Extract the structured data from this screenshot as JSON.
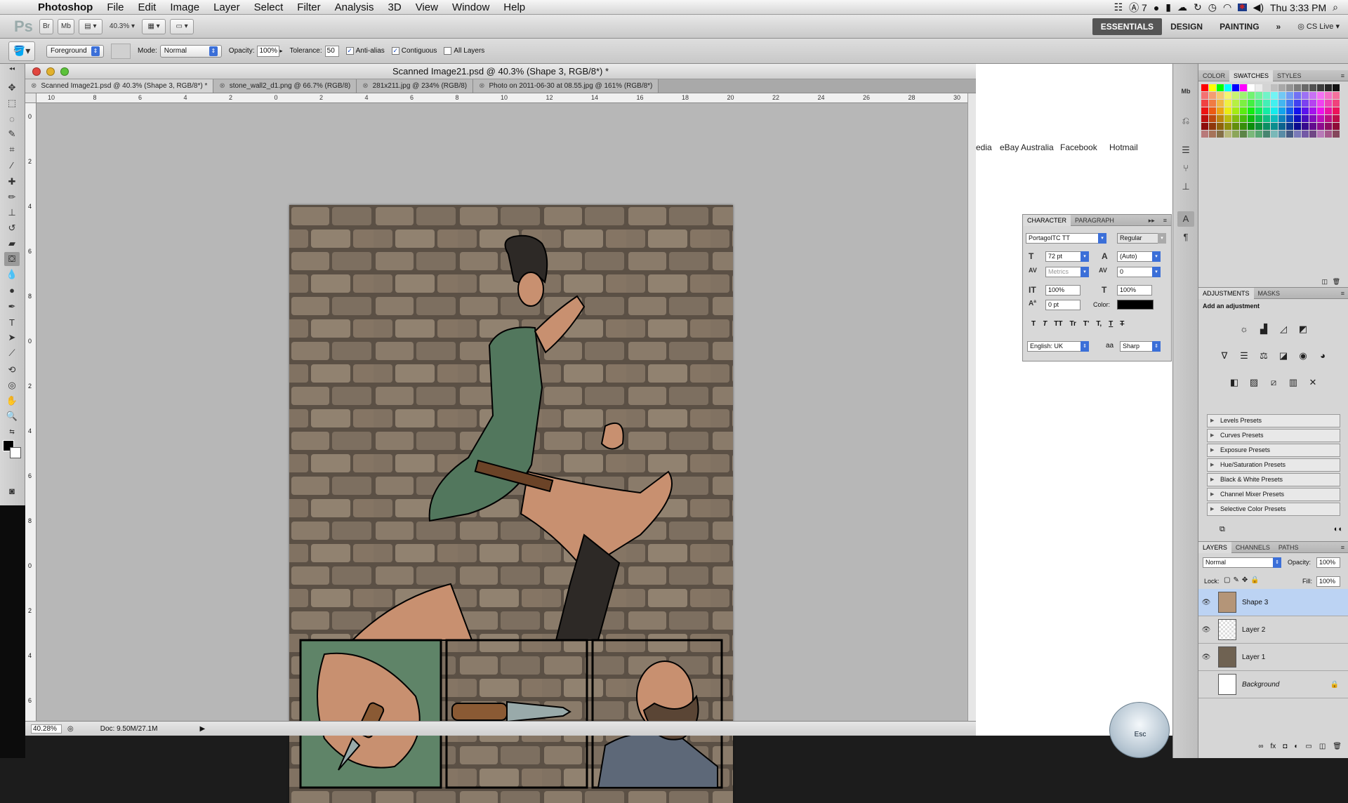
{
  "menubar": {
    "app": "Photoshop",
    "items": [
      "File",
      "Edit",
      "Image",
      "Layer",
      "Select",
      "Filter",
      "Analysis",
      "3D",
      "View",
      "Window",
      "Help"
    ],
    "right": {
      "battery_count": "7",
      "clock": "Thu 3:33 PM"
    }
  },
  "appbar": {
    "ps_logo": "Ps",
    "bridge": "Br",
    "minibridge": "Mb",
    "zoom": "40.3%",
    "workspaces": [
      "ESSENTIALS",
      "DESIGN",
      "PAINTING"
    ],
    "more": "»",
    "cslive": "CS Live"
  },
  "options": {
    "fill_source": "Foreground",
    "mode_label": "Mode:",
    "mode": "Normal",
    "opacity_label": "Opacity:",
    "opacity": "100%",
    "tolerance_label": "Tolerance:",
    "tolerance": "50",
    "antialias": "Anti-alias",
    "contiguous": "Contiguous",
    "all_layers": "All Layers"
  },
  "document": {
    "title": "Scanned Image21.psd @ 40.3% (Shape 3, RGB/8*) *",
    "tabs": [
      {
        "label": "Scanned Image21.psd @ 40.3% (Shape 3, RGB/8*) *"
      },
      {
        "label": "stone_wall2_d1.png @ 66.7% (RGB/8)"
      },
      {
        "label": "281x211.jpg @ 234% (RGB/8)"
      },
      {
        "label": "Photo on 2011-06-30 at 08.55.jpg @ 161% (RGB/8*)"
      }
    ],
    "ruler_h": [
      "10",
      "8",
      "6",
      "4",
      "2",
      "0",
      "2",
      "4",
      "6",
      "8",
      "10",
      "12",
      "14",
      "16",
      "18",
      "20",
      "22",
      "24",
      "26",
      "28",
      "30"
    ],
    "ruler_v": [
      "0",
      "2",
      "4",
      "6",
      "8",
      "0",
      "2",
      "4",
      "6",
      "8",
      "0",
      "2",
      "4",
      "6"
    ],
    "status_zoom": "40.28%",
    "status_doc": "Doc: 9.50M/27.1M"
  },
  "browser": {
    "links": [
      "edia",
      "eBay Australia",
      "Facebook",
      "Hotmail"
    ]
  },
  "character": {
    "tabs": [
      "CHARACTER",
      "PARAGRAPH"
    ],
    "font": "PortagolTC TT",
    "style": "Regular",
    "size": "72 pt",
    "leading": "(Auto)",
    "kerning": "Metrics",
    "tracking": "0",
    "vscale": "100%",
    "hscale": "100%",
    "baseline": "0 pt",
    "color_label": "Color:",
    "language": "English: UK",
    "aa_label": "aa",
    "antialias": "Sharp",
    "style_buttons": [
      "T",
      "T",
      "TT",
      "Tr",
      "T'",
      "T,",
      "T",
      "T"
    ]
  },
  "swatches": {
    "tabs": [
      "COLOR",
      "SWATCHES",
      "STYLES"
    ]
  },
  "adjustments": {
    "tabs": [
      "ADJUSTMENTS",
      "MASKS"
    ],
    "heading": "Add an adjustment",
    "presets": [
      "Levels Presets",
      "Curves Presets",
      "Exposure Presets",
      "Hue/Saturation Presets",
      "Black & White Presets",
      "Channel Mixer Presets",
      "Selective Color Presets"
    ]
  },
  "layers": {
    "tabs": [
      "LAYERS",
      "CHANNELS",
      "PATHS"
    ],
    "blend": "Normal",
    "opacity_label": "Opacity:",
    "opacity": "100%",
    "lock_label": "Lock:",
    "fill_label": "Fill:",
    "fill": "100%",
    "items": [
      {
        "name": "Shape 3"
      },
      {
        "name": "Layer 2"
      },
      {
        "name": "Layer 1"
      },
      {
        "name": "Background"
      }
    ]
  },
  "esc": "Esc",
  "colors": {
    "accent": "#3b6fd8",
    "selection": "#bcd3f3"
  }
}
